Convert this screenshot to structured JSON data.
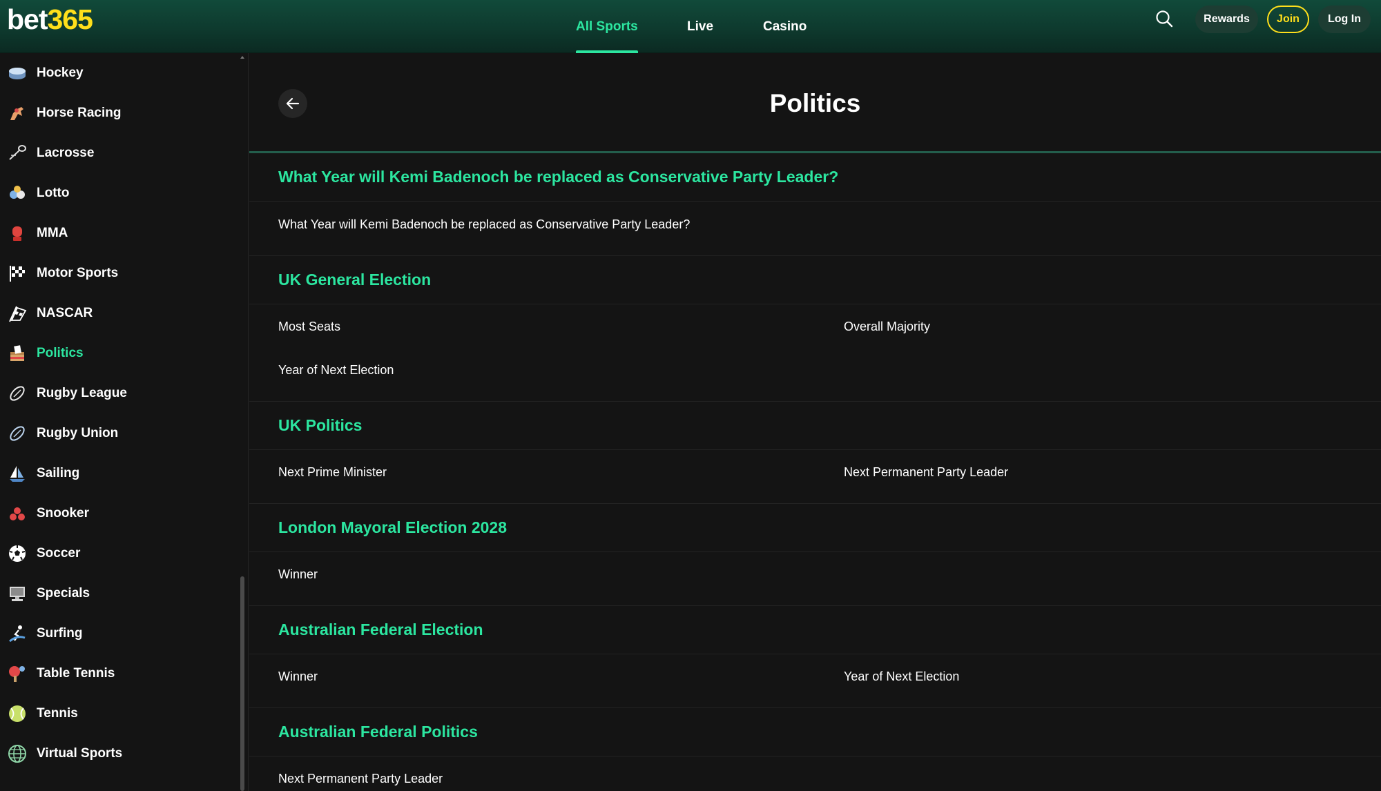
{
  "header": {
    "logo_prefix": "bet",
    "logo_suffix": "365",
    "nav": [
      "All Sports",
      "Live",
      "Casino"
    ],
    "rewards_label": "Rewards",
    "join_label": "Join",
    "login_label": "Log In"
  },
  "sidebar": {
    "items": [
      {
        "label": "Hockey",
        "icon": "hockey-puck-icon"
      },
      {
        "label": "Horse Racing",
        "icon": "horse-icon"
      },
      {
        "label": "Lacrosse",
        "icon": "lacrosse-stick-icon"
      },
      {
        "label": "Lotto",
        "icon": "lotto-balls-icon"
      },
      {
        "label": "MMA",
        "icon": "boxing-glove-icon"
      },
      {
        "label": "Motor Sports",
        "icon": "checkered-flag-icon"
      },
      {
        "label": "NASCAR",
        "icon": "race-flag-icon"
      },
      {
        "label": "Politics",
        "icon": "ballot-box-icon"
      },
      {
        "label": "Rugby League",
        "icon": "rugby-ball-icon"
      },
      {
        "label": "Rugby Union",
        "icon": "rugby-ball-icon"
      },
      {
        "label": "Sailing",
        "icon": "sailboat-icon"
      },
      {
        "label": "Snooker",
        "icon": "snooker-balls-icon"
      },
      {
        "label": "Soccer",
        "icon": "soccer-ball-icon"
      },
      {
        "label": "Specials",
        "icon": "monitor-icon"
      },
      {
        "label": "Surfing",
        "icon": "surfer-icon"
      },
      {
        "label": "Table Tennis",
        "icon": "table-tennis-icon"
      },
      {
        "label": "Tennis",
        "icon": "tennis-ball-icon"
      },
      {
        "label": "Virtual Sports",
        "icon": "globe-icon"
      }
    ],
    "active": "Politics"
  },
  "main": {
    "title": "Politics",
    "sections": [
      {
        "heading": "What Year will Kemi Badenoch be replaced as Conservative Party Leader?",
        "links": [
          "What Year will Kemi Badenoch be replaced as Conservative Party Leader?"
        ]
      },
      {
        "heading": "UK General Election",
        "links": [
          "Most Seats",
          "Overall Majority",
          "Year of Next Election"
        ]
      },
      {
        "heading": "UK Politics",
        "links": [
          "Next Prime Minister",
          "Next Permanent Party Leader"
        ]
      },
      {
        "heading": "London Mayoral Election 2028",
        "links": [
          "Winner"
        ]
      },
      {
        "heading": "Australian Federal Election",
        "links": [
          "Winner",
          "Year of Next Election"
        ]
      },
      {
        "heading": "Australian Federal Politics",
        "links": [
          "Next Permanent Party Leader"
        ]
      }
    ]
  },
  "colors": {
    "accent": "#2ce6a0",
    "brand_yellow": "#ffdf1b",
    "header_green": "#114a3a",
    "background": "#141414"
  }
}
